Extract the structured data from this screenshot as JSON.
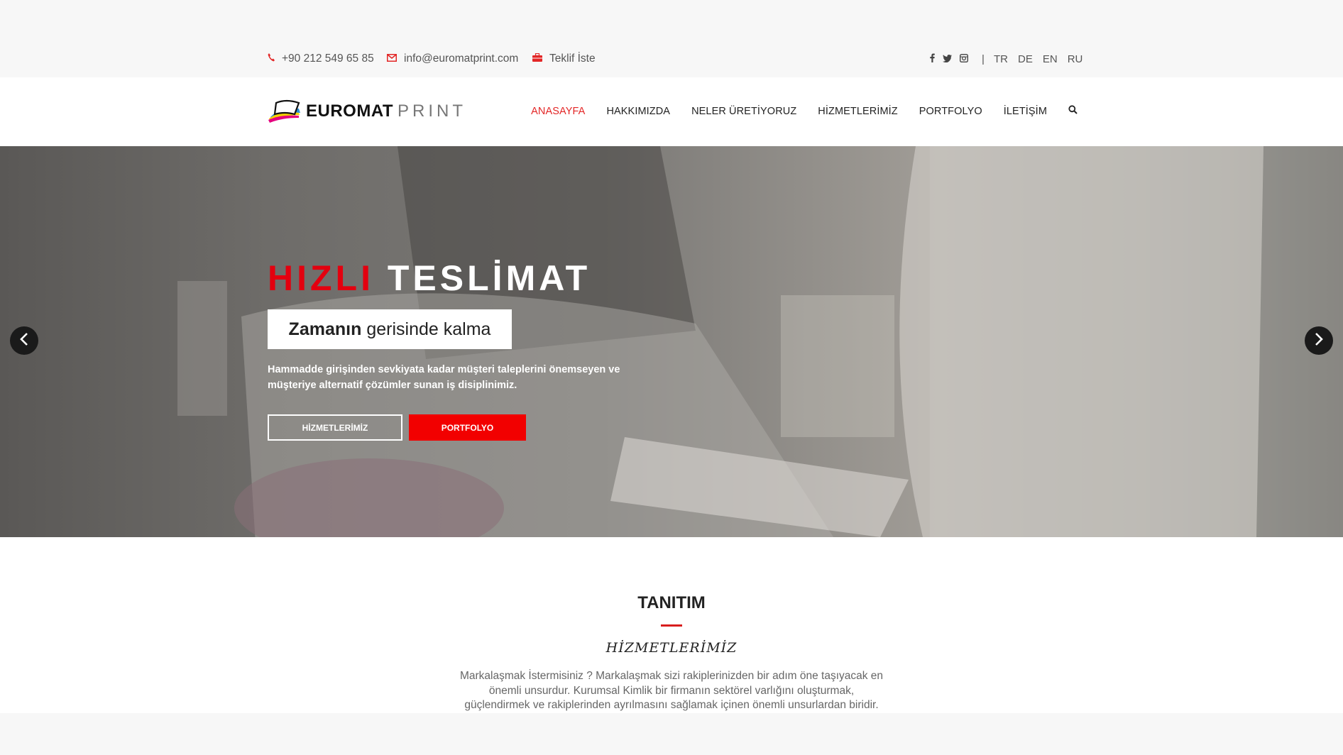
{
  "topbar": {
    "phone": "+90 212 549 65 85",
    "email": "info@euromatprint.com",
    "quote": "Teklif İste",
    "separator": "|",
    "languages": [
      "TR",
      "DE",
      "EN",
      "RU"
    ]
  },
  "header": {
    "logo_bold": "EUROMAT",
    "logo_light": "PRINT",
    "nav": [
      "ANASAYFA",
      "HAKKIMIZDA",
      "NELER ÜRETİYORUZ",
      "HİZMETLERİMİZ",
      "PORTFOLYO",
      "İLETİŞİM"
    ],
    "active_index": 0
  },
  "hero": {
    "title_red": "HIZLI",
    "title_white": "TESLİMAT",
    "subtitle_bold": "Zamanın",
    "subtitle_rest": "gerisinde kalma",
    "description": "Hammadde girişinden sevkiyata kadar müşteri taleplerini önemseyen ve müşteriye alternatif çözümler sunan iş disiplinimiz.",
    "button_outline": "HİZMETLERİMİZ",
    "button_red": "PORTFOLYO"
  },
  "section": {
    "title": "TANITIM",
    "subtitle": "HİZMETLERİMİZ",
    "text": "Markalaşmak İstermisiniz ? Markalaşmak sizi rakiplerinizden bir adım öne taşıyacak en önemli unsurdur. Kurumsal Kimlik bir firmanın sektörel varlığını oluşturmak, güçlendirmek ve rakiplerinden ayrılmasını sağlamak içinen önemli unsurlardan biridir. Kimlik için doğru"
  },
  "colors": {
    "accent": "#e3000f",
    "nav_active": "#e32626",
    "divider": "#d81e1e"
  },
  "icons": {
    "phone": "phone-icon",
    "email": "envelope-icon",
    "quote": "briefcase-icon",
    "facebook": "facebook-icon",
    "twitter": "twitter-icon",
    "instagram": "instagram-icon",
    "search": "search-icon",
    "prev": "chevron-left-icon",
    "next": "chevron-right-icon"
  }
}
